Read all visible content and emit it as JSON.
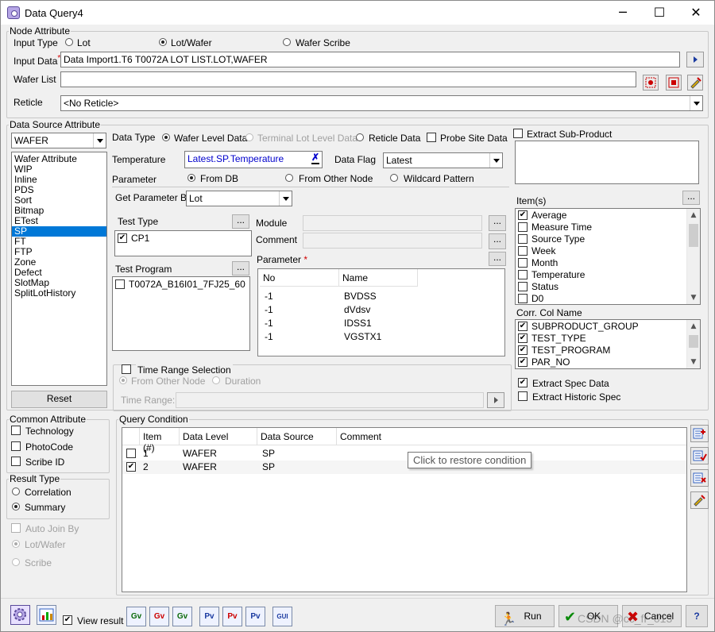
{
  "window": {
    "title": "Data Query4",
    "minimize": "─",
    "maximize": "☐",
    "close": "✕"
  },
  "node_attribute": {
    "legend": "Node Attribute",
    "input_type_label": "Input Type",
    "input_types": [
      "Lot",
      "Lot/Wafer",
      "Wafer Scribe"
    ],
    "input_data_label": "Input Data",
    "input_data_required": "*",
    "input_data_value": "Data Import1.T6 T0072A LOT LIST.LOT,WAFER",
    "wafer_list_label": "Wafer List",
    "wafer_list_value": "",
    "reticle_label": "Reticle",
    "reticle_value": "<No Reticle>"
  },
  "data_source": {
    "legend": "Data Source Attribute",
    "source_combo": "WAFER",
    "source_items": [
      "Wafer Attribute",
      "WIP",
      "Inline",
      "PDS",
      "Sort",
      "Bitmap",
      "ETest",
      "SP",
      "FT",
      "FTP",
      "Zone",
      "Defect",
      "SlotMap",
      "SplitLotHistory"
    ],
    "reset_label": "Reset",
    "data_type_label": "Data Type",
    "data_types": [
      "Wafer Level Data",
      "Terminal Lot Level Data",
      "Reticle Data"
    ],
    "probe_site_label": "Probe Site Data",
    "temperature_label": "Temperature",
    "temperature_value": "Latest.SP.Temperature",
    "data_flag_label": "Data Flag",
    "data_flag_value": "Latest",
    "parameter_label": "Parameter",
    "parameter_sources": [
      "From DB",
      "From Other Node",
      "Wildcard Pattern"
    ],
    "get_param_label": "Get Parameter By",
    "get_param_value": "Lot",
    "test_type_label": "Test Type",
    "test_types": [
      {
        "label": "CP1",
        "checked": "✔"
      }
    ],
    "test_program_label": "Test Program",
    "test_programs": [
      {
        "label": "T0072A_B16I01_7FJ25_60",
        "checked": ""
      }
    ],
    "module_label": "Module",
    "comment_label": "Comment",
    "param_table_label": "Parameter",
    "param_required": "*",
    "param_columns": [
      "No",
      "Name"
    ],
    "param_rows": [
      {
        "no": "-1",
        "name": "BVDSS"
      },
      {
        "no": "-1",
        "name": "dVdsv"
      },
      {
        "no": "-1",
        "name": "IDSS1"
      },
      {
        "no": "-1",
        "name": "VGSTX1"
      }
    ],
    "time_range_selection": "Time Range Selection",
    "time_from_other": "From Other Node",
    "time_duration": "Duration",
    "time_range_label": "Time Range:",
    "ellipsis": "...",
    "extract_sub_product": "Extract Sub-Product",
    "items_label": "Item(s)",
    "items": [
      {
        "label": "Average",
        "checked": "✔"
      },
      {
        "label": "Measure Time",
        "checked": ""
      },
      {
        "label": "Source Type",
        "checked": ""
      },
      {
        "label": "Week",
        "checked": ""
      },
      {
        "label": "Month",
        "checked": ""
      },
      {
        "label": "Temperature",
        "checked": ""
      },
      {
        "label": "Status",
        "checked": ""
      },
      {
        "label": "D0",
        "checked": ""
      }
    ],
    "corr_label": "Corr. Col Name",
    "corr_items": [
      {
        "label": "SUBPRODUCT_GROUP",
        "checked": "✔"
      },
      {
        "label": "TEST_TYPE",
        "checked": "✔"
      },
      {
        "label": "TEST_PROGRAM",
        "checked": "✔"
      },
      {
        "label": "PAR_NO",
        "checked": "✔"
      }
    ],
    "extract_spec": "Extract Spec Data",
    "extract_historic": "Extract Historic Spec"
  },
  "common_attribute": {
    "legend": "Common Attribute",
    "items": [
      "Technology",
      "PhotoCode",
      "Scribe ID"
    ]
  },
  "result_type": {
    "legend": "Result Type",
    "options": [
      "Correlation",
      "Summary"
    ]
  },
  "auto_join": {
    "label": "Auto Join By",
    "options": [
      "Lot/Wafer",
      "Scribe"
    ]
  },
  "query_condition": {
    "legend": "Query Condition",
    "columns": [
      "Item (#)",
      "Data Level",
      "Data Source",
      "Comment"
    ],
    "rows": [
      {
        "checked": "",
        "item": "1",
        "level": "WAFER",
        "source": "SP",
        "comment": ""
      },
      {
        "checked": "✔",
        "item": "2",
        "level": "WAFER",
        "source": "SP",
        "comment": ""
      }
    ],
    "tooltip": "Click to restore condition"
  },
  "bottom": {
    "view_result": "View result",
    "view_checked": "✔",
    "toolbar": [
      "Gv",
      "Gv",
      "Gv",
      "Pv",
      "Pv",
      "Pv",
      "GUI"
    ],
    "run": "Run",
    "ok": "OK",
    "cancel": "Cancel",
    "watermark": "CSDN @cc_fr_013"
  },
  "colors": {
    "selection": "#0078d7",
    "temperature_text": "#0000cc",
    "required": "#d00000"
  }
}
